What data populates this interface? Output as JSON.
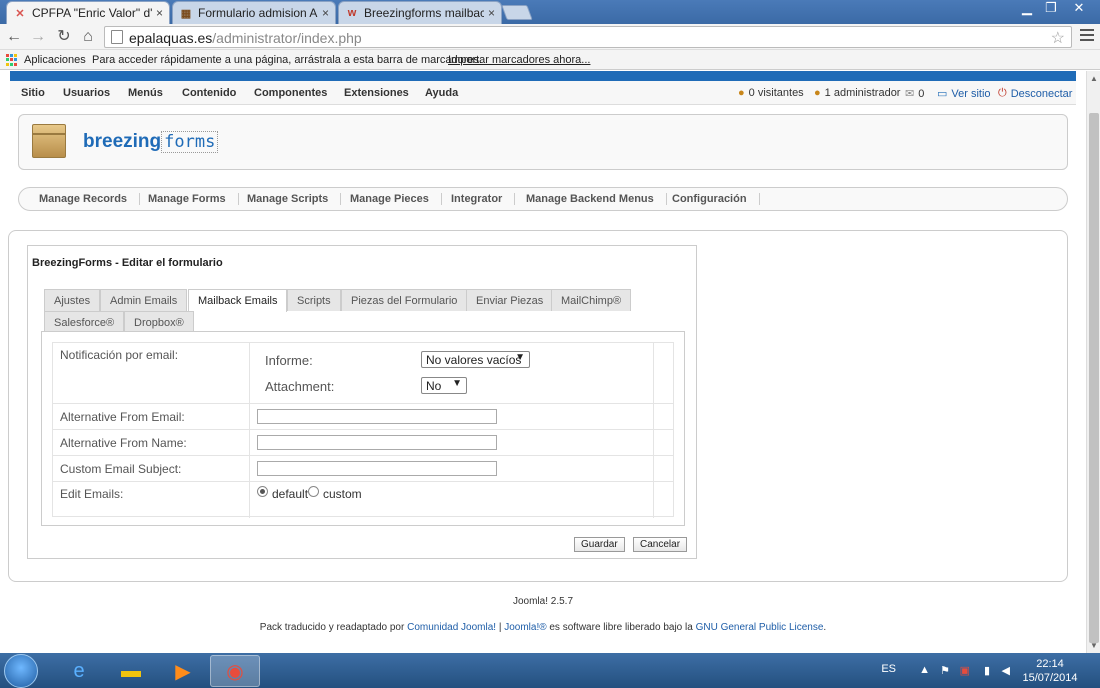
{
  "browser": {
    "tabs": [
      {
        "title": "CPFPA \"Enric Valor\" d'Ala",
        "favicon": "joomla-icon",
        "active": true
      },
      {
        "title": "Formulario admision AU",
        "favicon": "form-icon",
        "active": false
      },
      {
        "title": "Breezingforms mailback n",
        "favicon": "w-icon",
        "active": false
      }
    ],
    "tab_close": "×",
    "url_host": "epalaquas.es",
    "url_path": "/administrator/index.php",
    "bookmarks": {
      "apps_label": "Aplicaciones",
      "message": "Para acceder rápidamente a una página, arrástrala a esta barra de marcadores.",
      "import_link": "Importar marcadores ahora..."
    }
  },
  "joomla_menu": {
    "items": [
      "Sitio",
      "Usuarios",
      "Menús",
      "Contenido",
      "Componentes",
      "Extensiones",
      "Ayuda"
    ],
    "status": {
      "visitors": "0 visitantes",
      "admins": "1 administrador",
      "messages": "0",
      "view_site": "Ver sitio",
      "logout": "Desconectar"
    }
  },
  "brand": {
    "part1": "breezing",
    "part2": "forms"
  },
  "subnav": [
    "Manage Records",
    "Manage Forms",
    "Manage Scripts",
    "Manage Pieces",
    "Integrator",
    "Manage Backend Menus",
    "Configuración"
  ],
  "form": {
    "title": "BreezingForms - Editar el formulario",
    "tabs_row1": [
      "Ajustes",
      "Admin Emails",
      "Mailback Emails",
      "Scripts",
      "Piezas del Formulario",
      "Enviar Piezas",
      "MailChimp®"
    ],
    "tabs_row2": [
      "Salesforce®",
      "Dropbox®"
    ],
    "active_tab": "Mailback Emails",
    "notification_label": "Notificación por email:",
    "informe_label": "Informe:",
    "informe_value": "No valores vacíos",
    "attachment_label": "Attachment:",
    "attachment_value": "No",
    "alt_from_email_label": "Alternative From Email:",
    "alt_from_email_value": "",
    "alt_from_name_label": "Alternative From Name:",
    "alt_from_name_value": "",
    "custom_subject_label": "Custom Email Subject:",
    "custom_subject_value": "",
    "edit_emails_label": "Edit Emails:",
    "radio_default": "default",
    "radio_custom": "custom",
    "save": "Guardar",
    "cancel": "Cancelar"
  },
  "footer": {
    "version": "Joomla! 2.5.7",
    "credit_pre": "Pack traducido y readaptado por ",
    "credit_link1": "Comunidad Joomla!",
    "credit_sep": " | ",
    "credit_link2": "Joomla!®",
    "credit_mid": " es software libre liberado bajo la ",
    "credit_link3": "GNU General Public License",
    "credit_end": "."
  },
  "taskbar": {
    "lang": "ES",
    "time": "22:14",
    "date": "15/07/2014"
  },
  "colors": {
    "joomla_blue": "#1f6bb7",
    "link": "#1f5ea8"
  }
}
